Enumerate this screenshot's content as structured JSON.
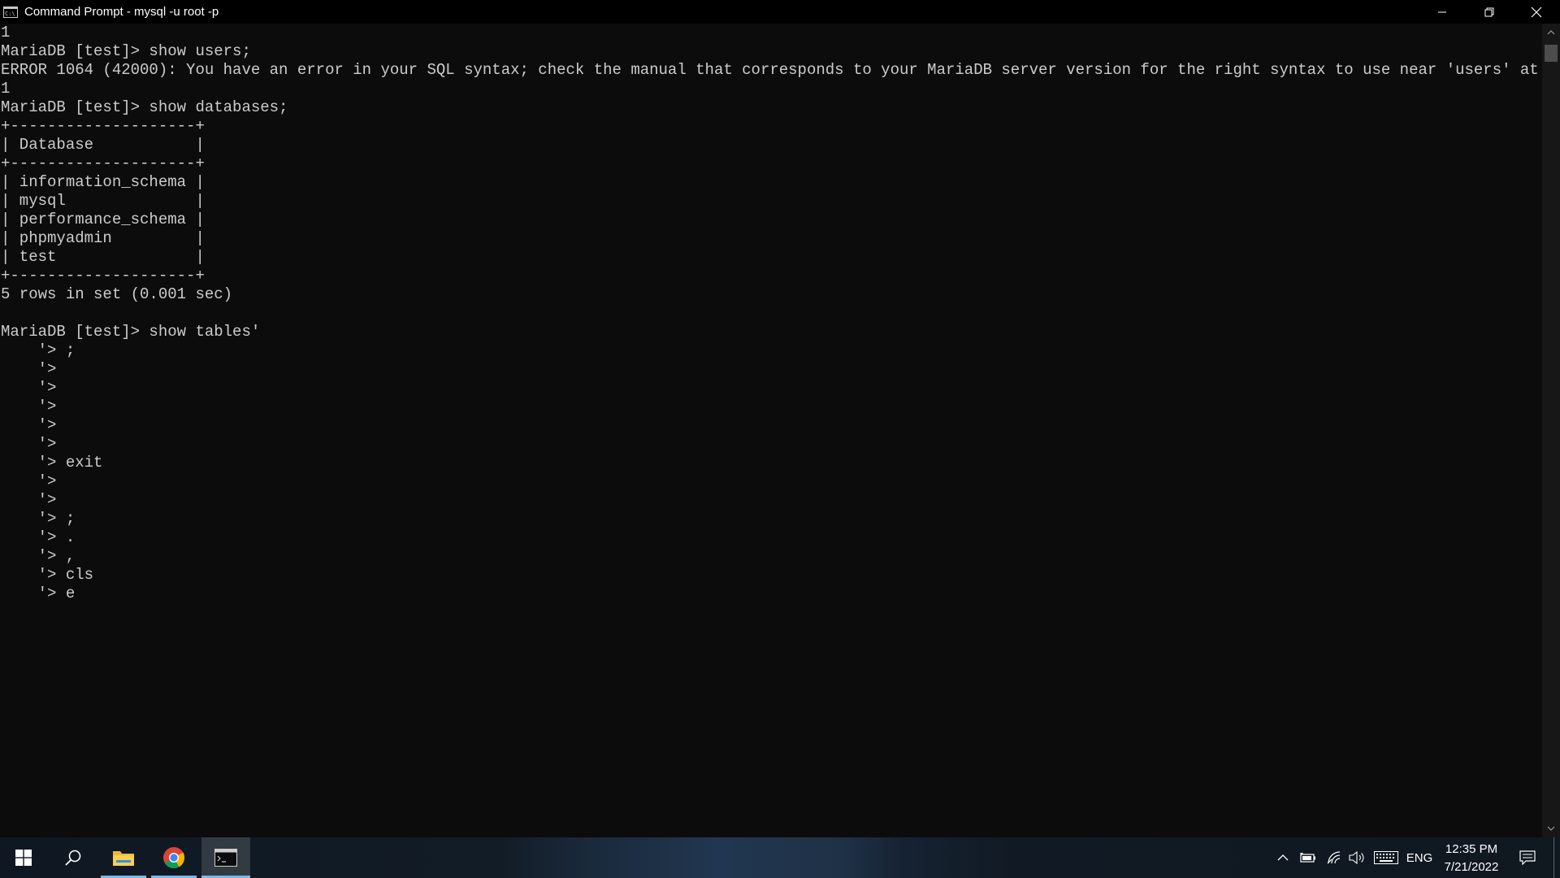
{
  "window": {
    "title": "Command Prompt - mysql  -u root -p"
  },
  "console": {
    "lines": [
      "1",
      "MariaDB [test]> show users;",
      "ERROR 1064 (42000): You have an error in your SQL syntax; check the manual that corresponds to your MariaDB server version for the right syntax to use near 'users' at line",
      "1",
      "MariaDB [test]> show databases;",
      "+--------------------+",
      "| Database           |",
      "+--------------------+",
      "| information_schema |",
      "| mysql              |",
      "| performance_schema |",
      "| phpmyadmin         |",
      "| test               |",
      "+--------------------+",
      "5 rows in set (0.001 sec)",
      "",
      "MariaDB [test]> show tables'",
      "    '> ;",
      "    '>",
      "    '>",
      "    '>",
      "    '>",
      "    '>",
      "    '> exit",
      "    '>",
      "    '>",
      "    '> ;",
      "    '> .",
      "    '> ,",
      "    '> cls",
      "    '> e"
    ]
  },
  "taskbar": {
    "apps": [
      {
        "name": "File Explorer",
        "icon": "folder-icon"
      },
      {
        "name": "Google Chrome",
        "icon": "chrome-icon"
      },
      {
        "name": "Command Prompt",
        "icon": "terminal-icon"
      }
    ],
    "tray": {
      "language": "ENG",
      "time": "12:35 PM",
      "date": "7/21/2022"
    }
  },
  "colors": {
    "console_bg": "#0c0c0c",
    "console_text": "#cccccc",
    "taskbar_active_underline": "#76b9ed"
  }
}
